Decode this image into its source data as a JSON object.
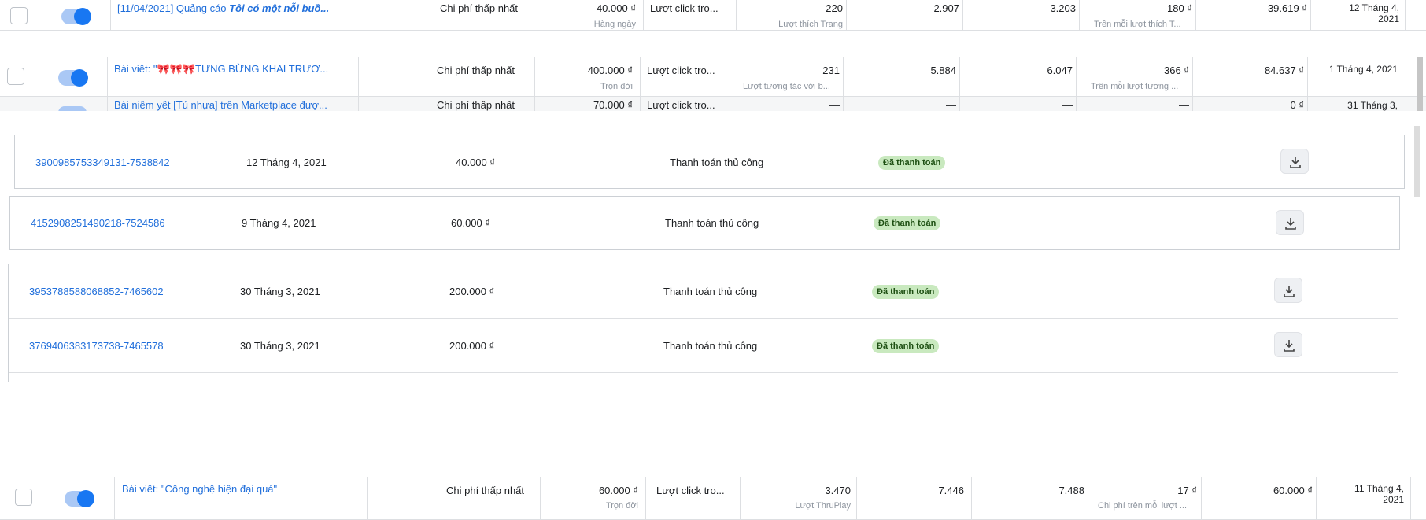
{
  "ad_rows": [
    {
      "name": "[11/04/2021] Quảng cáo ",
      "name_italic": "Tôi có một nỗi buồ...",
      "bid_strategy": "Chi phí thấp nhất",
      "budget": "40.000 ₫",
      "budget_sub": "Hàng ngày",
      "attribution": "Lượt click tro...",
      "results": "220",
      "results_sub": "Lượt thích Trang",
      "reach": "2.907",
      "impressions": "3.203",
      "cost_per_result": "180 ₫",
      "cost_per_result_sub": "Trên mỗi lượt thích T...",
      "amount_spent": "39.619 ₫",
      "ends": "12 Tháng 4, 2021"
    },
    {
      "name": "Bài viết: \"🎀🎀🎀TƯNG BỪNG KHAI TRƯƠ...",
      "bid_strategy": "Chi phí thấp nhất",
      "budget": "400.000 ₫",
      "budget_sub": "Trọn đời",
      "attribution": "Lượt click tro...",
      "results": "231",
      "results_sub": "Lượt tương tác với b...",
      "reach": "5.884",
      "impressions": "6.047",
      "cost_per_result": "366 ₫",
      "cost_per_result_sub": "Trên mỗi lượt tương ...",
      "amount_spent": "84.637 ₫",
      "ends": "1 Tháng 4, 2021"
    },
    {
      "name": "Bài niêm yết [Tủ nhựa] trên Marketplace đượ...",
      "bid_strategy": "Chi phí thấp nhất",
      "budget": "70.000 ₫",
      "attribution": "Lượt click tro...",
      "results": "—",
      "reach": "—",
      "impressions": "—",
      "cost_per_result": "—",
      "amount_spent": "0 ₫",
      "ends": "31 Tháng 3,"
    },
    {
      "name": "Bài viết: \"Công nghệ hiện đại quá\"",
      "bid_strategy": "Chi phí thấp nhất",
      "budget": "60.000 ₫",
      "budget_sub": "Trọn đời",
      "attribution": "Lượt click tro...",
      "results": "3.470",
      "results_sub": "Lượt ThruPlay",
      "reach": "7.446",
      "impressions": "7.488",
      "cost_per_result": "17 ₫",
      "cost_per_result_sub": "Chi phí trên mỗi lượt ...",
      "amount_spent": "60.000 ₫",
      "ends": "11 Tháng 4, 2021"
    }
  ],
  "transactions": [
    {
      "id": "3900985753349131-7538842",
      "date": "12 Tháng 4, 2021",
      "amount": "40.000 ₫",
      "method": "Thanh toán thủ công",
      "status": "Đã thanh toán"
    },
    {
      "id": "4152908251490218-7524586",
      "date": "9 Tháng 4, 2021",
      "amount": "60.000 ₫",
      "method": "Thanh toán thủ công",
      "status": "Đã thanh toán"
    },
    {
      "id": "3953788588068852-7465602",
      "date": "30 Tháng 3, 2021",
      "amount": "200.000 ₫",
      "method": "Thanh toán thủ công",
      "status": "Đã thanh toán"
    },
    {
      "id": "3769406383173738-7465578",
      "date": "30 Tháng 3, 2021",
      "amount": "200.000 ₫",
      "method": "Thanh toán thủ công",
      "status": "Đã thanh toán"
    }
  ],
  "icons": {
    "download": "download-icon",
    "checkbox": "checkbox",
    "toggle": "toggle-switch"
  },
  "colors": {
    "link": "#216fdb",
    "paid_badge_bg": "#c9e9bf",
    "toggle_on": "#1877f2"
  }
}
